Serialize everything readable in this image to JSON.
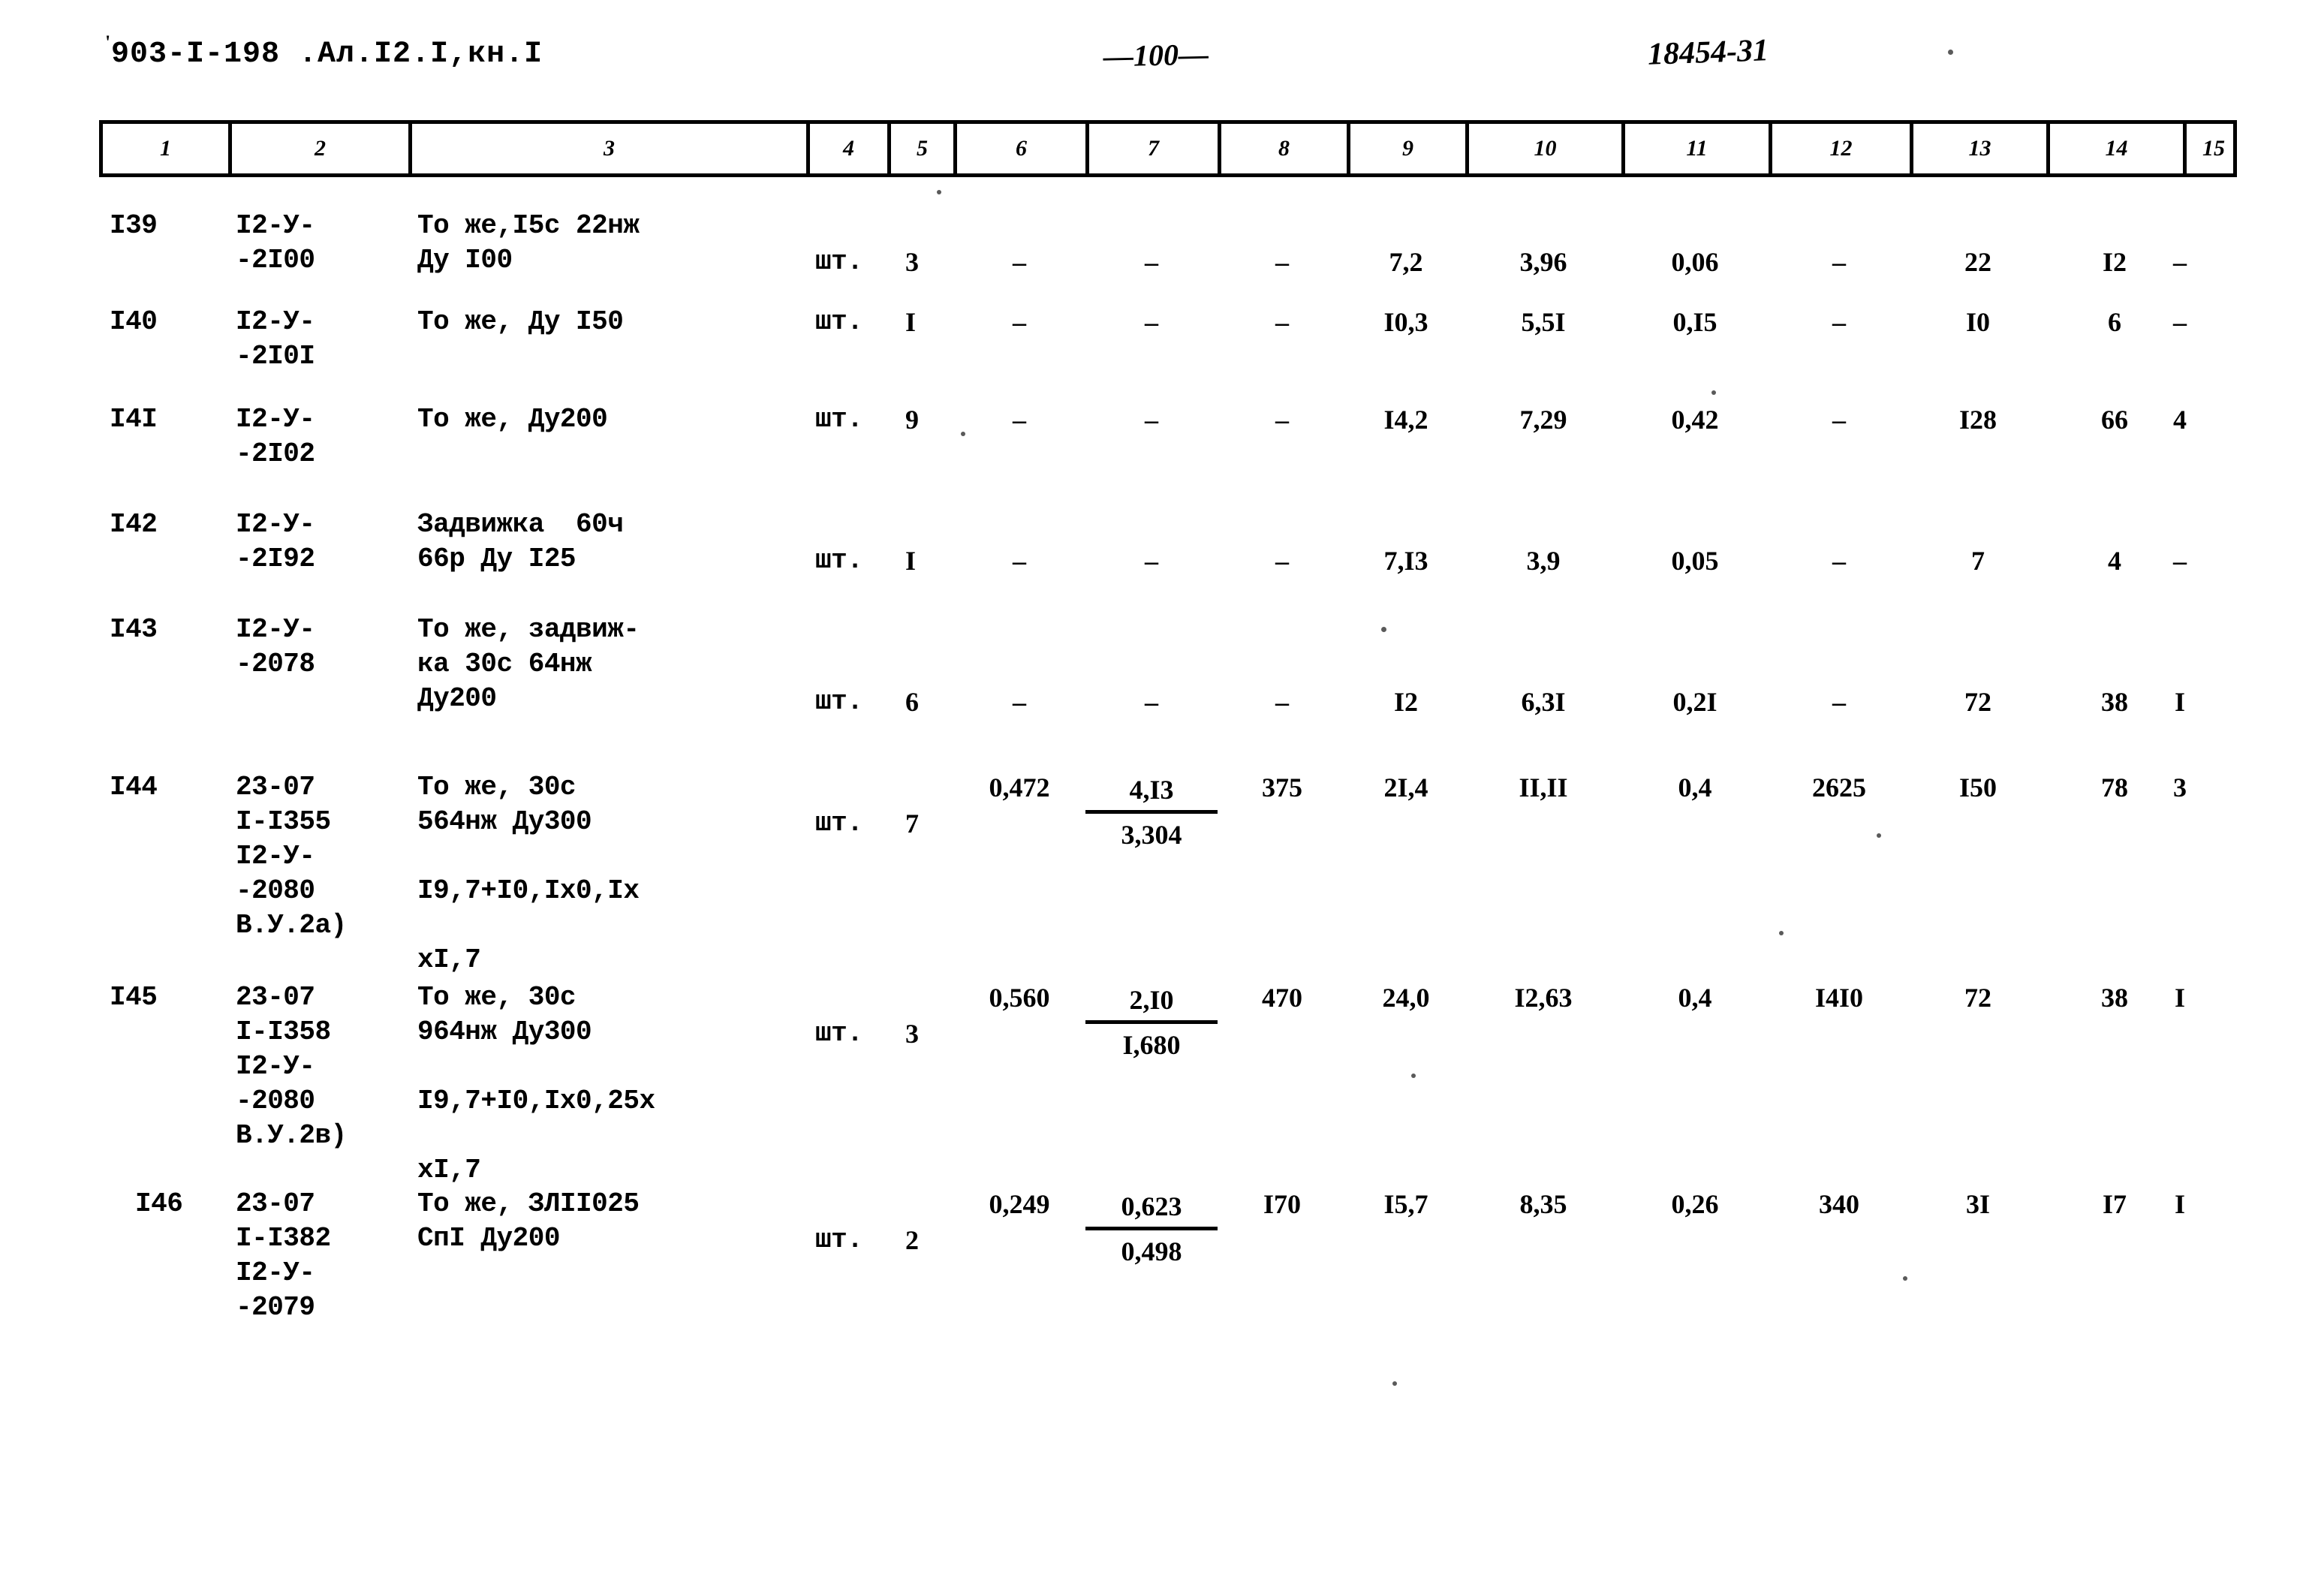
{
  "page": {
    "doc_code": "903-I-198 .Ал.I2.I,кн.I",
    "page_number": "—100—",
    "archive_number": "18454-31"
  },
  "table": {
    "column_headers": [
      "1",
      "2",
      "3",
      "4",
      "5",
      "6",
      "7",
      "8",
      "9",
      "10",
      "11",
      "12",
      "13",
      "14",
      "15"
    ],
    "rows": [
      {
        "c1": "I39",
        "c2": "I2-У-\n-2I00",
        "c3": "То же,I5с 22нж\nДу I00",
        "c4": "шт.",
        "c5": "3",
        "c6": "–",
        "c7": "–",
        "c8": "–",
        "c9": "7,2",
        "c10": "3,96",
        "c11": "0,06",
        "c12": "–",
        "c13": "22",
        "c14": "I2",
        "c15": "–"
      },
      {
        "c1": "I40",
        "c2": "I2-У-\n-2I0I",
        "c3": "То же, Ду I50",
        "c4": "шт.",
        "c5": "I",
        "c6": "–",
        "c7": "–",
        "c8": "–",
        "c9": "I0,3",
        "c10": "5,5I",
        "c11": "0,I5",
        "c12": "–",
        "c13": "I0",
        "c14": "6",
        "c15": "–"
      },
      {
        "c1": "I4I",
        "c2": "I2-У-\n-2I02",
        "c3": "То же, Ду200",
        "c4": "шт.",
        "c5": "9",
        "c6": "–",
        "c7": "–",
        "c8": "–",
        "c9": "I4,2",
        "c10": "7,29",
        "c11": "0,42",
        "c12": "–",
        "c13": "I28",
        "c14": "66",
        "c15": "4"
      },
      {
        "c1": "I42",
        "c2": "I2-У-\n-2I92",
        "c3": "Задвижка  60ч\n66р Ду I25",
        "c4": "шт.",
        "c5": "I",
        "c6": "–",
        "c7": "–",
        "c8": "–",
        "c9": "7,I3",
        "c10": "3,9",
        "c11": "0,05",
        "c12": "–",
        "c13": "7",
        "c14": "4",
        "c15": "–"
      },
      {
        "c1": "I43",
        "c2": "I2-У-\n-2078",
        "c3": "То же, задвиж-\nка 30с 64нж\nДу200",
        "c4": "шт.",
        "c5": "6",
        "c6": "–",
        "c7": "–",
        "c8": "–",
        "c9": "I2",
        "c10": "6,3I",
        "c11": "0,2I",
        "c12": "–",
        "c13": "72",
        "c14": "38",
        "c15": "I"
      },
      {
        "c1": "I44",
        "c2": "23-07\nI-I355\nI2-У-\n-2080\nВ.У.2а)",
        "c3": "То же, 30с\n564нж Ду300\n\nI9,7+I0,Iх0,Iх\n\nхI,7",
        "c4": "шт.",
        "c5": "7",
        "c6": "0,472",
        "c7_num": "4,I3",
        "c7_den": "3,304",
        "c8": "375",
        "c9": "2I,4",
        "c10": "II,II",
        "c11": "0,4",
        "c12": "2625",
        "c13": "I50",
        "c14": "78",
        "c15": "3"
      },
      {
        "c1": "I45",
        "c2": "23-07\nI-I358\nI2-У-\n-2080\nВ.У.2в)",
        "c3": "То же, 30с\n964нж Ду300\n\nI9,7+I0,Iх0,25х\n\nхI,7",
        "c4": "шт.",
        "c5": "3",
        "c6": "0,560",
        "c7_num": "2,I0",
        "c7_den": "I,680",
        "c8": "470",
        "c9": "24,0",
        "c10": "I2,63",
        "c11": "0,4",
        "c12": "I4I0",
        "c13": "72",
        "c14": "38",
        "c15": "I"
      },
      {
        "c1": "I46",
        "c2": "23-07\nI-I382\nI2-У-\n-2079",
        "c3": "То же, ЗЛII025\nСпI Ду200",
        "c4": "шт.",
        "c5": "2",
        "c6": "0,249",
        "c7_num": "0,623",
        "c7_den": "0,498",
        "c8": "I70",
        "c9": "I5,7",
        "c10": "8,35",
        "c11": "0,26",
        "c12": "340",
        "c13": "3I",
        "c14": "I7",
        "c15": "I"
      }
    ]
  }
}
